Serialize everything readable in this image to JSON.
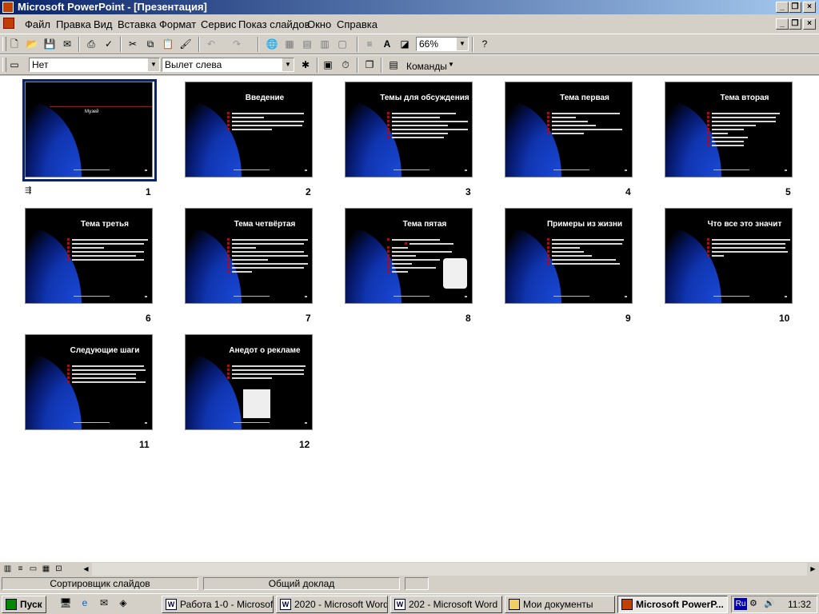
{
  "window": {
    "title": "Microsoft PowerPoint - [Презентация]"
  },
  "menu": [
    "Файл",
    "Правка",
    "Вид",
    "Вставка",
    "Формат",
    "Сервис",
    "Показ слайдов",
    "Окно",
    "Справка"
  ],
  "toolbar_standard": {
    "zoom": "66%"
  },
  "toolbar_sorter": {
    "transition_effect": "Нет",
    "text_effect": "Вылет слева",
    "commands_label": "Команды"
  },
  "slides": [
    {
      "num": "1",
      "title": "Музей"
    },
    {
      "num": "2",
      "title": "Введение"
    },
    {
      "num": "3",
      "title": "Темы для обсуждения"
    },
    {
      "num": "4",
      "title": "Тема первая"
    },
    {
      "num": "5",
      "title": "Тема вторая"
    },
    {
      "num": "6",
      "title": "Тема третья"
    },
    {
      "num": "7",
      "title": "Тема четвёртая"
    },
    {
      "num": "8",
      "title": "Тема пятая"
    },
    {
      "num": "9",
      "title": "Примеры из жизни"
    },
    {
      "num": "10",
      "title": "Что все это значит"
    },
    {
      "num": "11",
      "title": "Следующие шаги"
    },
    {
      "num": "12",
      "title": "Анедот о рекламе"
    }
  ],
  "status": {
    "view": "Сортировщик слайдов",
    "design": "Общий доклад"
  },
  "taskbar": {
    "start": "Пуск",
    "tasks": [
      "Работа 1-0 - Microsoft...",
      "2020 - Microsoft Word",
      "202 - Microsoft Word",
      "Мои документы",
      "Microsoft PowerP..."
    ],
    "lang": "Ru",
    "clock": "11:32"
  }
}
